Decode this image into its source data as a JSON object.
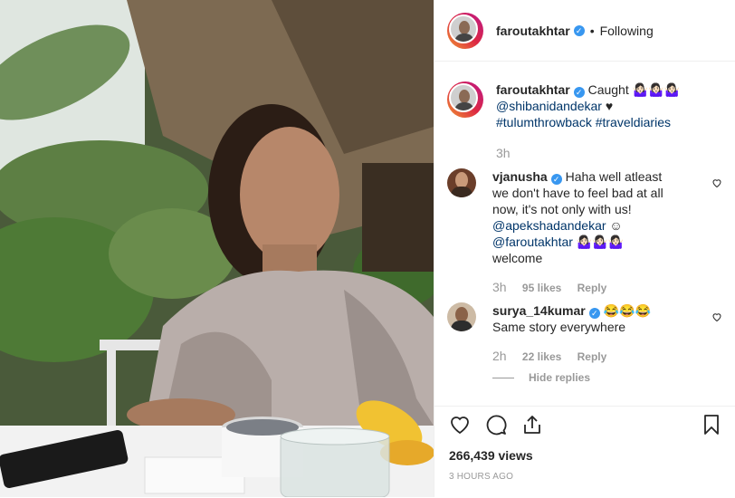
{
  "header": {
    "username": "faroutakhtar",
    "separator": "•",
    "follow_status": "Following"
  },
  "caption": {
    "username": "faroutakhtar",
    "text": "Caught 🤷🏻‍♀️🤷🏻‍♀️🤷🏻‍♀️",
    "mention": "@shibanidandekar",
    "heart": "♥",
    "hashtag1": "#tulumthrowback",
    "hashtag2": "#traveldiaries",
    "time": "3h"
  },
  "comments": [
    {
      "username": "vjanusha",
      "text": "Haha well atleast we don't have to feel bad at all now, it's not only with us!",
      "mention1": "@apekshadandekar",
      "mention1_suffix": " ☺",
      "mention2": "@faroutakhtar",
      "mention2_suffix": " 🤷🏻‍♀️🤷🏻‍♀️🤷🏻‍♀️ welcome",
      "time": "3h",
      "likes": "95 likes",
      "reply": "Reply"
    },
    {
      "username": "surya_14kumar",
      "text": "😂😂😂Same story everywhere",
      "time": "2h",
      "likes": "22 likes",
      "reply": "Reply"
    }
  ],
  "hide_replies": "Hide replies",
  "footer": {
    "views": "266,439 views",
    "timestamp": "3 HOURS AGO"
  },
  "icons": [
    "heart-icon",
    "comment-icon",
    "share-icon",
    "bookmark-icon",
    "verified-icon"
  ],
  "colors": {
    "link": "#003569",
    "verified": "#3897f0",
    "muted": "#999999"
  }
}
